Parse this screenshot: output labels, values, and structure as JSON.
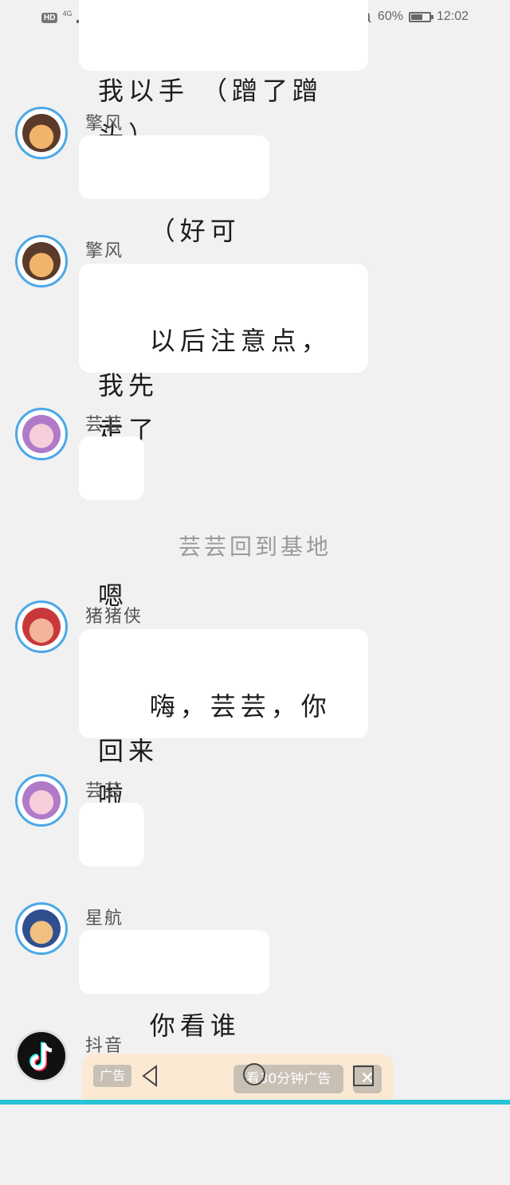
{
  "status_bar": {
    "hd": "HD",
    "signal": "4G",
    "battery_text": "60%",
    "battery_level": 0.6,
    "time": "12:02"
  },
  "top_bubble": {
    "text": "我以手 （蹭了蹭\n头）"
  },
  "messages": [
    {
      "sender": "擎风",
      "text": "（好可爱）",
      "avatar": "qingfeng-avatar"
    },
    {
      "sender": "擎风",
      "text": "以后注意点，我先\n走了",
      "avatar": "qingfeng-avatar"
    },
    {
      "sender": "芸芸",
      "text": "嗯",
      "avatar": "yunyun-avatar"
    },
    {
      "sender": "猪猪侠",
      "text": "嗨，芸芸，你回来\n啦",
      "avatar": "zhuzhuxia-avatar"
    },
    {
      "sender": "芸芸",
      "text": "嗯",
      "avatar": "yunyun-avatar"
    },
    {
      "sender": "星航",
      "text": "你看谁来啦",
      "avatar": "xinghang-avatar"
    },
    {
      "sender": "抖音",
      "avatar": "douyin-avatar"
    }
  ],
  "system_message": "芸芸回到基地",
  "ad": {
    "label": "广告",
    "timer": "看30分钟广告",
    "close": "✕"
  },
  "colors": {
    "background": "#f1f1f1",
    "avatar_ring": "#4aa8e8",
    "bottom_strip": "#27c3d6"
  }
}
